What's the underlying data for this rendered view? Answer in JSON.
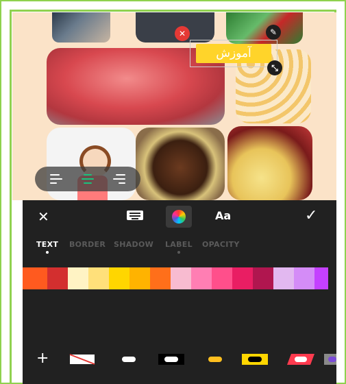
{
  "canvas": {
    "text_sticker": {
      "text": "آموزش",
      "background": "#ffd42a",
      "text_color": "#ffffff"
    },
    "controls": [
      "delete-icon",
      "edit-pencil-icon",
      "resize-icon"
    ]
  },
  "align_bar": {
    "options": [
      "align-left",
      "align-center",
      "align-right"
    ],
    "selected": "align-center",
    "active_color": "#19c37d"
  },
  "toolbar": {
    "close": "✕",
    "keyboard": "keyboard-icon",
    "color": "color-wheel-icon",
    "font_label": "Aa",
    "confirm": "✓"
  },
  "tabs": [
    {
      "label": "TEXT",
      "active": true,
      "has_dot": true
    },
    {
      "label": "BORDER",
      "active": false,
      "has_dot": false
    },
    {
      "label": "SHADOW",
      "active": false,
      "has_dot": false
    },
    {
      "label": "LABEL",
      "active": false,
      "has_dot": true
    },
    {
      "label": "OPACITY",
      "active": false,
      "has_dot": false
    }
  ],
  "swatches": [
    "#ff5a1f",
    "#d32f2f",
    "#fff3c4",
    "#ffe07a",
    "#ffd600",
    "#ffb300",
    "#ff6f1a",
    "#f8bbd0",
    "#ff7eb3",
    "#ff4f8b",
    "#e91e63",
    "#b0164f",
    "#e2b8f0",
    "#d48cf7",
    "#c440ff"
  ],
  "styles": {
    "plus": "+",
    "items": [
      "none-style",
      "white-pill",
      "black-box-white-pill",
      "yellow-pill",
      "yellow-box-black-pill",
      "red-parallelogram-white-pill",
      "gray-partial"
    ]
  },
  "colors": {
    "panel": "#212121",
    "canvas_bg": "#fbe3c8",
    "frame_green": "#8fd14f"
  }
}
